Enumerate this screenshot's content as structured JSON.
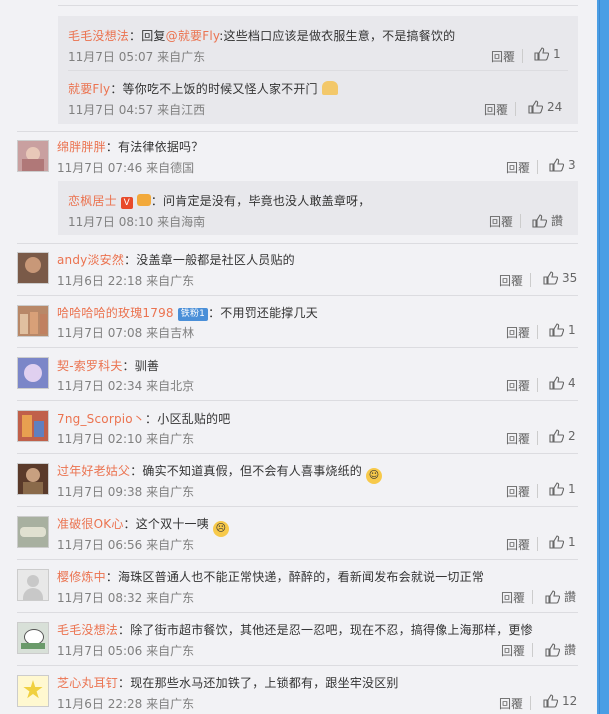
{
  "replies_top": [
    {
      "user": "毛毛没想法",
      "prefix": "：回复",
      "mention": "@就要Fly",
      "text": ":这些档口应该是做衣服生意，不是搞餐饮的",
      "time": "11月7日 05:07",
      "location": "来自广东",
      "reply_label": "回覆",
      "likes": "1"
    },
    {
      "user": "就要Fly",
      "text": "：等你吃不上饭的时候又怪人家不开门",
      "time": "11月7日 04:57",
      "location": "来自江西",
      "reply_label": "回覆",
      "likes": "24"
    }
  ],
  "comments": [
    {
      "user": "绵胖胖胖",
      "text": "：有法律依据吗？",
      "time": "11月7日 07:46",
      "location": "来自德国",
      "reply_label": "回覆",
      "likes": "3",
      "avatar_color": "#c9a0a0",
      "reply": {
        "user": "恋枫居士",
        "text": "：问肯定是没有，毕竟也没人敢盖章呀，",
        "time": "11月7日 08:10",
        "location": "来自海南",
        "reply_label": "回覆",
        "likes": "讚"
      }
    },
    {
      "user": "andy淡安然",
      "text": "：没盖章一般都是社区人员贴的",
      "time": "11月6日 22:18",
      "location": "来自广东",
      "reply_label": "回覆",
      "likes": "35",
      "avatar_color": "#7a5a48"
    },
    {
      "user": "哈哈哈哈的玫瑰1798",
      "badge": "铁粉1",
      "text": "：不用罚还能撑几天",
      "time": "11月7日 07:08",
      "location": "来自吉林",
      "reply_label": "回覆",
      "likes": "1",
      "avatar_color": "#b88868"
    },
    {
      "user": "契-索罗科夫",
      "text": "：驯善",
      "time": "11月7日 02:34",
      "location": "来自北京",
      "reply_label": "回覆",
      "likes": "4",
      "avatar_color": "#7b86c8"
    },
    {
      "user": "7ng_Scorpio丶",
      "text": "：小区乱贴的吧",
      "time": "11月7日 02:10",
      "location": "来自广东",
      "reply_label": "回覆",
      "likes": "2",
      "avatar_color": "#c0604a"
    },
    {
      "user": "过年好老姑父",
      "text": "：确实不知道真假，但不会有人喜事烧纸的",
      "time": "11月7日 09:38",
      "location": "来自广东",
      "reply_label": "回覆",
      "likes": "1",
      "avatar_color": "#5a3a2a",
      "emoji": true
    },
    {
      "user": "准破很OK心",
      "text": "：这个双十一咦",
      "time": "11月7日 06:56",
      "location": "来自广东",
      "reply_label": "回覆",
      "likes": "1",
      "avatar_color": "#a8b0a0",
      "emoji": true
    },
    {
      "user": "樱修炼中",
      "text": "：海珠区普通人也不能正常快递，醉醉的，看新闻发布会就说一切正常",
      "time": "11月7日 08:32",
      "location": "来自广东",
      "reply_label": "回覆",
      "likes": "讚",
      "avatar_color": "#e8e8e8"
    },
    {
      "user": "毛毛没想法",
      "text": "：除了街市超市餐饮，其他还是忍一忍吧，现在不忍，搞得像上海那样，更惨",
      "time": "11月7日 05:06",
      "location": "来自广东",
      "reply_label": "回覆",
      "likes": "讚",
      "avatar_color": "#d8e0d8"
    },
    {
      "user": "芝心丸耳钉",
      "text": "：现在那些水马还加铁了，上锁都有，跟坐牢没区别",
      "time": "11月6日 22:28",
      "location": "来自广东",
      "reply_label": "回覆",
      "likes": "12",
      "avatar_color": "#f0d040"
    }
  ]
}
